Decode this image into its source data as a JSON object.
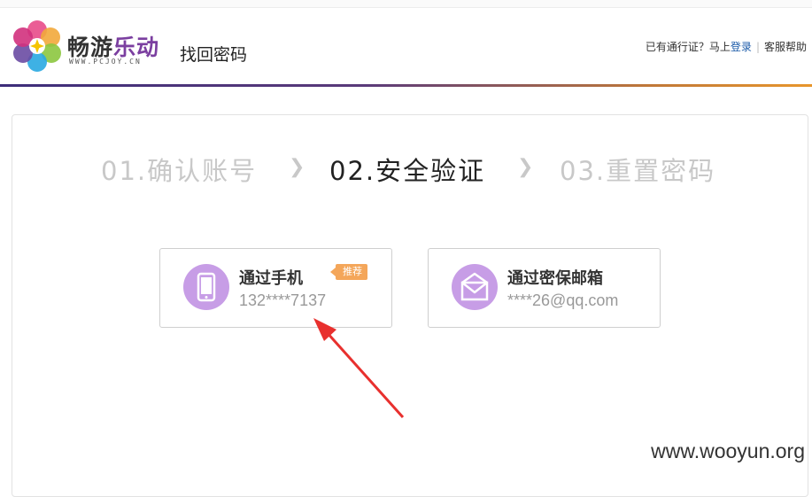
{
  "header": {
    "brand_cn": "畅游",
    "brand_accent": "乐动",
    "brand_url": "WWW.PCJOY.CN",
    "page_title": "找回密码",
    "account_prompt": "已有通行证？马上",
    "login_link": "登录",
    "help_link": "客服帮助"
  },
  "steps": [
    {
      "label": "01.确认账号",
      "state": "inactive"
    },
    {
      "label": "02.安全验证",
      "state": "active"
    },
    {
      "label": "03.重置密码",
      "state": "inactive"
    }
  ],
  "step_separator": "❯",
  "options": {
    "phone": {
      "title": "通过手机",
      "value": "132****7137",
      "badge": "推荐",
      "icon": "mobile-phone-icon"
    },
    "email": {
      "title": "通过密保邮箱",
      "value": "****26@qq.com",
      "icon": "envelope-icon"
    }
  },
  "watermark": "www.wooyun.org",
  "colors": {
    "accent_purple": "#7b3fa0",
    "icon_purple": "#c79de6",
    "badge_orange": "#f4a65a",
    "link_blue": "#1a5aa8",
    "annotation_red": "#e8302e"
  }
}
